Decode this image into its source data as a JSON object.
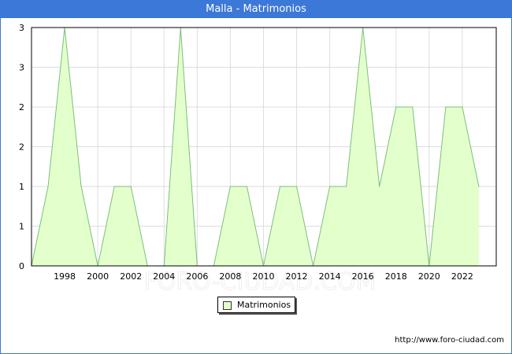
{
  "window": {
    "title": "Malla - Matrimonios"
  },
  "footer": {
    "url": "http://www.foro-ciudad.com"
  },
  "watermark": {
    "text": "FORO-CIUDAD.COM"
  },
  "colors": {
    "title_bar": "#3c78d8",
    "area_fill": "#e3ffcc",
    "area_line": "#7cbf7c",
    "grid": "#dddddd"
  },
  "chart_data": {
    "type": "area",
    "title": "Malla - Matrimonios",
    "xlabel": "",
    "ylabel": "",
    "x": [
      1996,
      1997,
      1998,
      1999,
      2000,
      2001,
      2002,
      2003,
      2004,
      2005,
      2006,
      2007,
      2008,
      2009,
      2010,
      2011,
      2012,
      2013,
      2014,
      2015,
      2016,
      2017,
      2018,
      2019,
      2020,
      2021,
      2022,
      2023
    ],
    "series": [
      {
        "name": "Matrimonios",
        "values": [
          0,
          1,
          3,
          1,
          0,
          1,
          1,
          0,
          0,
          3,
          0,
          0,
          1,
          1,
          0,
          1,
          1,
          0,
          1,
          1,
          3,
          1,
          2,
          2,
          0,
          2,
          2,
          1
        ]
      }
    ],
    "x_ticks": [
      1998,
      2000,
      2002,
      2004,
      2006,
      2008,
      2010,
      2012,
      2014,
      2016,
      2018,
      2020,
      2022
    ],
    "y_tick_labels": [
      "0",
      "1",
      "1",
      "2",
      "2",
      "3",
      "3"
    ],
    "xlim": [
      1996,
      2024.05
    ],
    "ylim": [
      0,
      3
    ],
    "grid": true,
    "legend_position": "bottom-center"
  }
}
